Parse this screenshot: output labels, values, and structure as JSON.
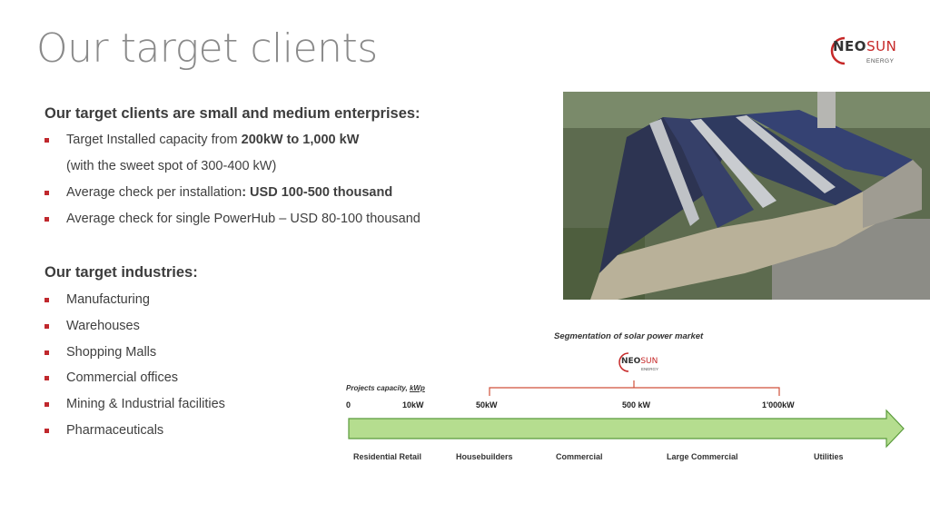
{
  "page": {
    "title": "Our target clients"
  },
  "logo": {
    "neo": "NEO",
    "sun": "SUN",
    "sub": "ENERGY"
  },
  "clients": {
    "heading": "Our target clients are small and medium enterprises:",
    "items": [
      {
        "pre": "Target Installed capacity from ",
        "bold": "200kW to 1,000 kW",
        "post": ""
      },
      {
        "pre": "Average check per installation",
        "bold": ": USD 100-500 thousand",
        "post": ""
      },
      {
        "pre": "Average check for single PowerHub – USD 80-100 thousand",
        "bold": "",
        "post": ""
      }
    ],
    "note": "(with the sweet spot of 300-400 kW)"
  },
  "industries": {
    "heading": "Our target industries:",
    "items": [
      "Manufacturing",
      "Warehouses",
      "Shopping Malls",
      "Commercial offices",
      "Mining & Industrial facilities",
      "Pharmaceuticals"
    ]
  },
  "segmentation": {
    "title": "Segmentation of solar power market",
    "axis_label_pre": "Projects capacity, ",
    "axis_label_unit": "kWp",
    "ticks": [
      "0",
      "10kW",
      "50kW",
      "500 kW",
      "1'000kW"
    ],
    "categories": [
      "Residential Retail",
      "Housebuilders",
      "Commercial",
      "Large Commercial",
      "Utilities"
    ],
    "logo_neo": "NEO",
    "logo_sun": "SUN",
    "logo_sub": "ENERGY",
    "arrow_color": "#b5dd8f",
    "bracket_color": "#d0503a"
  }
}
